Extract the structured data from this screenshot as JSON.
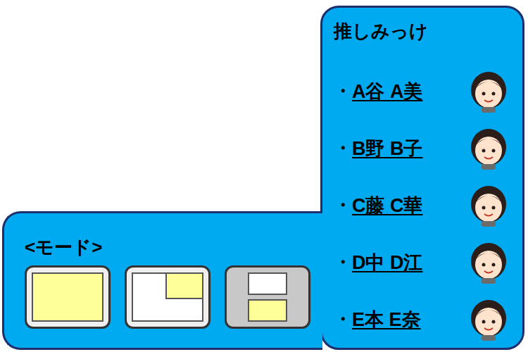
{
  "panel": {
    "title": "推しみっけ",
    "marker": "・",
    "members": [
      {
        "name": "A谷 A美"
      },
      {
        "name": "B野 B子"
      },
      {
        "name": "C藤 C華"
      },
      {
        "name": "D中 D江"
      },
      {
        "name": "E本 E奈"
      }
    ]
  },
  "modes": {
    "label": "<モード>",
    "items": [
      {
        "kind": "full",
        "selected": false
      },
      {
        "kind": "pip",
        "selected": false
      },
      {
        "kind": "split",
        "selected": true
      }
    ]
  }
}
